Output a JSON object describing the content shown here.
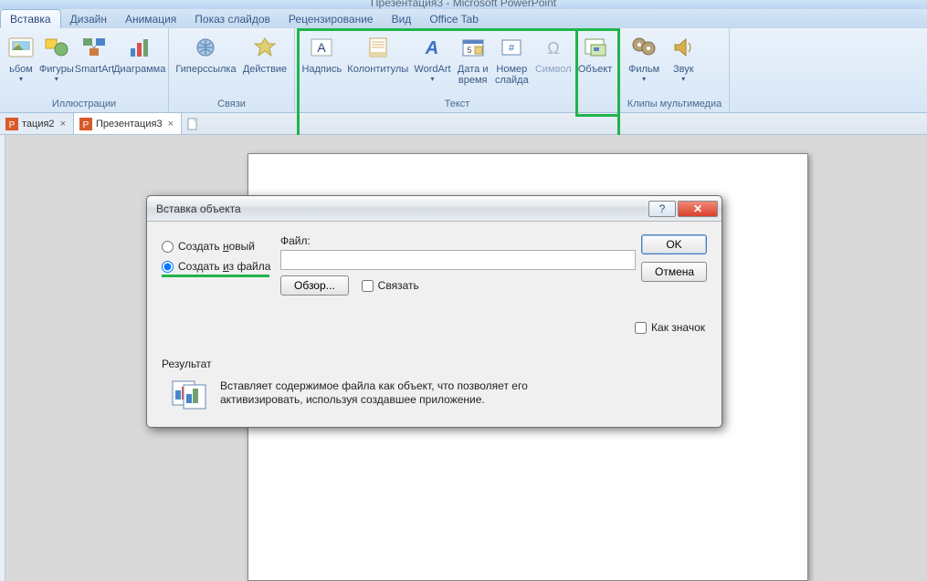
{
  "titlebar": {
    "app": "Презентация3 - Microsoft PowerPoint"
  },
  "tabs": {
    "items": [
      "Вставка",
      "Дизайн",
      "Анимация",
      "Показ слайдов",
      "Рецензирование",
      "Вид",
      "Office Tab"
    ],
    "active_index": 0
  },
  "ribbon": {
    "groups": [
      {
        "label": "Иллюстрации",
        "buttons": [
          {
            "name": "album-button",
            "icon": "album-icon",
            "label": "ьбом",
            "dropdown": true
          },
          {
            "name": "shapes-button",
            "icon": "shapes-icon",
            "label": "Фигуры",
            "dropdown": true
          },
          {
            "name": "smartart-button",
            "icon": "smartart-icon",
            "label": "SmartArt"
          },
          {
            "name": "chart-button",
            "icon": "chart-icon",
            "label": "Диаграмма"
          }
        ]
      },
      {
        "label": "Связи",
        "buttons": [
          {
            "name": "hyperlink-button",
            "icon": "hyperlink-icon",
            "label": "Гиперссылка"
          },
          {
            "name": "action-button",
            "icon": "action-icon",
            "label": "Действие"
          }
        ]
      },
      {
        "label": "Текст",
        "buttons": [
          {
            "name": "textbox-button",
            "icon": "textbox-icon",
            "label": "Надпись"
          },
          {
            "name": "headerfooter-button",
            "icon": "headerfooter-icon",
            "label": "Колонтитулы"
          },
          {
            "name": "wordart-button",
            "icon": "wordart-icon",
            "label": "WordArt",
            "dropdown": true
          },
          {
            "name": "datetime-button",
            "icon": "datetime-icon",
            "label": "Дата и\nвремя"
          },
          {
            "name": "slidenumber-button",
            "icon": "slidenumber-icon",
            "label": "Номер\nслайда"
          },
          {
            "name": "symbol-button",
            "icon": "symbol-icon",
            "label": "Символ",
            "disabled": true
          },
          {
            "name": "object-button",
            "icon": "object-icon",
            "label": "Объект"
          }
        ]
      },
      {
        "label": "Клипы мультимедиа",
        "buttons": [
          {
            "name": "movie-button",
            "icon": "movie-icon",
            "label": "Фильм",
            "dropdown": true
          },
          {
            "name": "sound-button",
            "icon": "sound-icon",
            "label": "Звук",
            "dropdown": true
          }
        ]
      }
    ]
  },
  "doc_tabs": {
    "items": [
      {
        "label": "тация2",
        "active": false
      },
      {
        "label": "Презентация3",
        "active": true
      }
    ]
  },
  "dialog": {
    "title": "Вставка объекта",
    "radio_new": "Создать новый",
    "radio_new_underline": "н",
    "radio_file": "Создать из файла",
    "radio_file_underline": "и",
    "file_label": "Файл:",
    "file_value": "",
    "browse": "Обзор...",
    "link": "Связать",
    "as_icon": "Как значок",
    "ok": "OK",
    "cancel": "Отмена",
    "result_title": "Результат",
    "result_text": "Вставляет содержимое файла как объект, что позволяет его активизировать, используя создавшее приложение."
  }
}
